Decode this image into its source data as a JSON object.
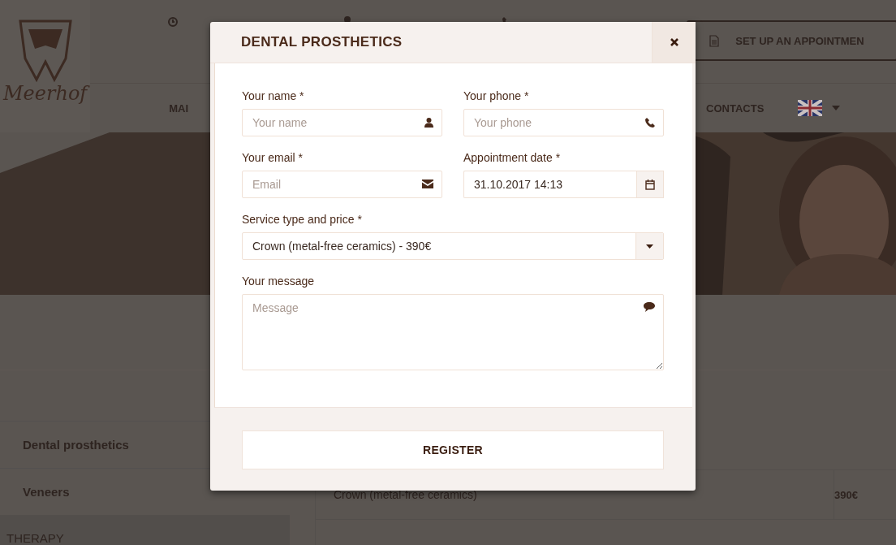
{
  "background": {
    "logo": {
      "name": "Meerhof"
    },
    "appointment_button": "SET UP AN APPOINTMEN",
    "nav": [
      "MAI",
      "CONTACTS"
    ],
    "hero": {
      "kind": "picture"
    },
    "sidebar": [
      {
        "kind": "item",
        "label": "Dental prosthetics"
      },
      {
        "kind": "item",
        "label": "Veneers"
      },
      {
        "kind": "heading",
        "label": "THERAPY"
      }
    ],
    "price_rows": [
      {
        "service": "Crown (metal-free ceramics)",
        "price": "390€"
      }
    ]
  },
  "modal": {
    "title": "DENTAL PROSTHETICS",
    "fields": [
      {
        "kind": "text",
        "label": "Your name *",
        "placeholder": "Your name"
      },
      {
        "kind": "text",
        "label": "Your phone *",
        "placeholder": "Your phone"
      },
      {
        "kind": "text",
        "label": "Your email *",
        "placeholder": "Email"
      },
      {
        "kind": "date",
        "label": "Appointment date *",
        "value": "31.10.2017 14:13"
      },
      {
        "kind": "select",
        "label": "Service type and price *",
        "value": "Crown (metal-free ceramics) - 390€"
      },
      {
        "kind": "textarea",
        "label": "Your message",
        "placeholder": "Message"
      }
    ],
    "submit": "REGISTER"
  }
}
